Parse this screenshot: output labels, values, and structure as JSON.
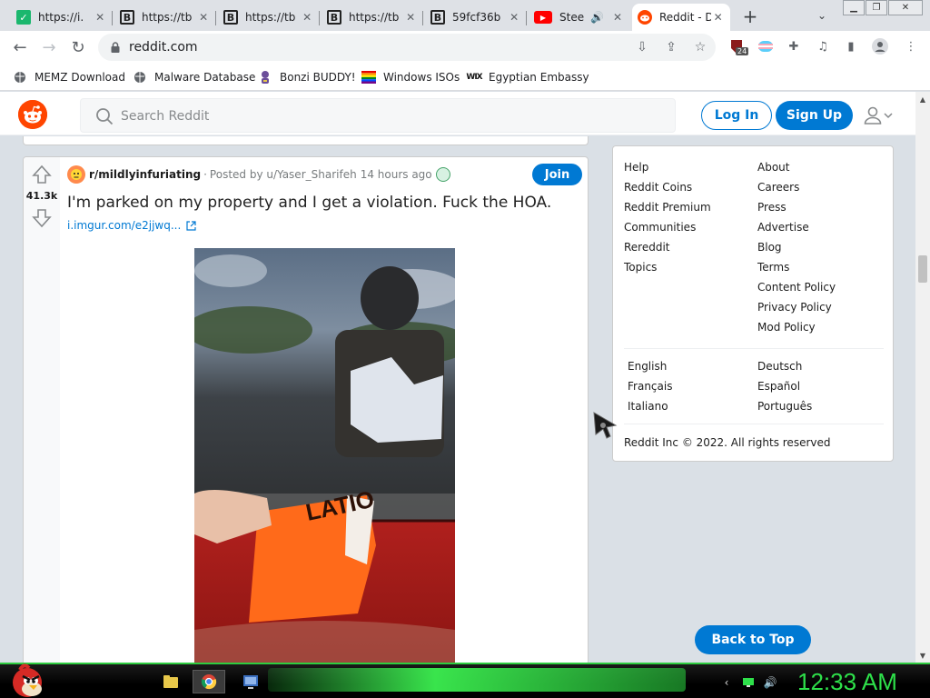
{
  "browser": {
    "tabs": [
      {
        "title": "https://i.",
        "favicon": "imgur-icon",
        "active": false
      },
      {
        "title": "https://tb",
        "favicon": "b-icon",
        "active": false
      },
      {
        "title": "https://tb",
        "favicon": "b-icon",
        "active": false
      },
      {
        "title": "https://tb",
        "favicon": "b-icon",
        "active": false
      },
      {
        "title": "59fcf36b",
        "favicon": "b-icon",
        "active": false
      },
      {
        "title": "Stee",
        "favicon": "youtube-icon",
        "active": false
      },
      {
        "title": "Reddit - D",
        "favicon": "reddit-icon",
        "active": true
      }
    ],
    "new_tab": "+",
    "url": "reddit.com",
    "extension_badge": "24",
    "bookmarks": [
      {
        "label": "MEMZ Download",
        "icon": "globe-icon"
      },
      {
        "label": "Malware Database",
        "icon": "globe-icon"
      },
      {
        "label": "Bonzi BUDDY!",
        "icon": "bonzi-icon"
      },
      {
        "label": "Windows ISOs",
        "icon": "windows-flag-icon"
      },
      {
        "label": "Egyptian Embassy",
        "icon": "wix-icon"
      }
    ]
  },
  "reddit": {
    "search_placeholder": "Search Reddit",
    "login_label": "Log In",
    "signup_label": "Sign Up",
    "post": {
      "score": "41.3k",
      "subreddit": "r/mildlyinfuriating",
      "posted_by": "Posted by u/Yaser_Sharifeh",
      "time_ago": "14 hours ago",
      "join_label": "Join",
      "title": "I'm parked on my property and I get a violation. Fuck the HOA.",
      "link": "i.imgur.com/e2jjwq..."
    },
    "sidebar": {
      "col1": [
        "Help",
        "Reddit Coins",
        "Reddit Premium",
        "Communities",
        "Rereddit",
        "Topics"
      ],
      "col2": [
        "About",
        "Careers",
        "Press",
        "Advertise",
        "Blog",
        "Terms",
        "Content Policy",
        "Privacy Policy",
        "Mod Policy"
      ],
      "languages_col1": [
        "English",
        "Français",
        "Italiano"
      ],
      "languages_col2": [
        "Deutsch",
        "Español",
        "Português"
      ],
      "copyright": "Reddit Inc © 2022. All rights reserved"
    },
    "back_to_top": "Back to Top",
    "brand_color": "#ff4500",
    "accent_color": "#0079d3"
  },
  "taskbar": {
    "clock": "12:33 AM",
    "accent_color": "#2ee04a"
  }
}
